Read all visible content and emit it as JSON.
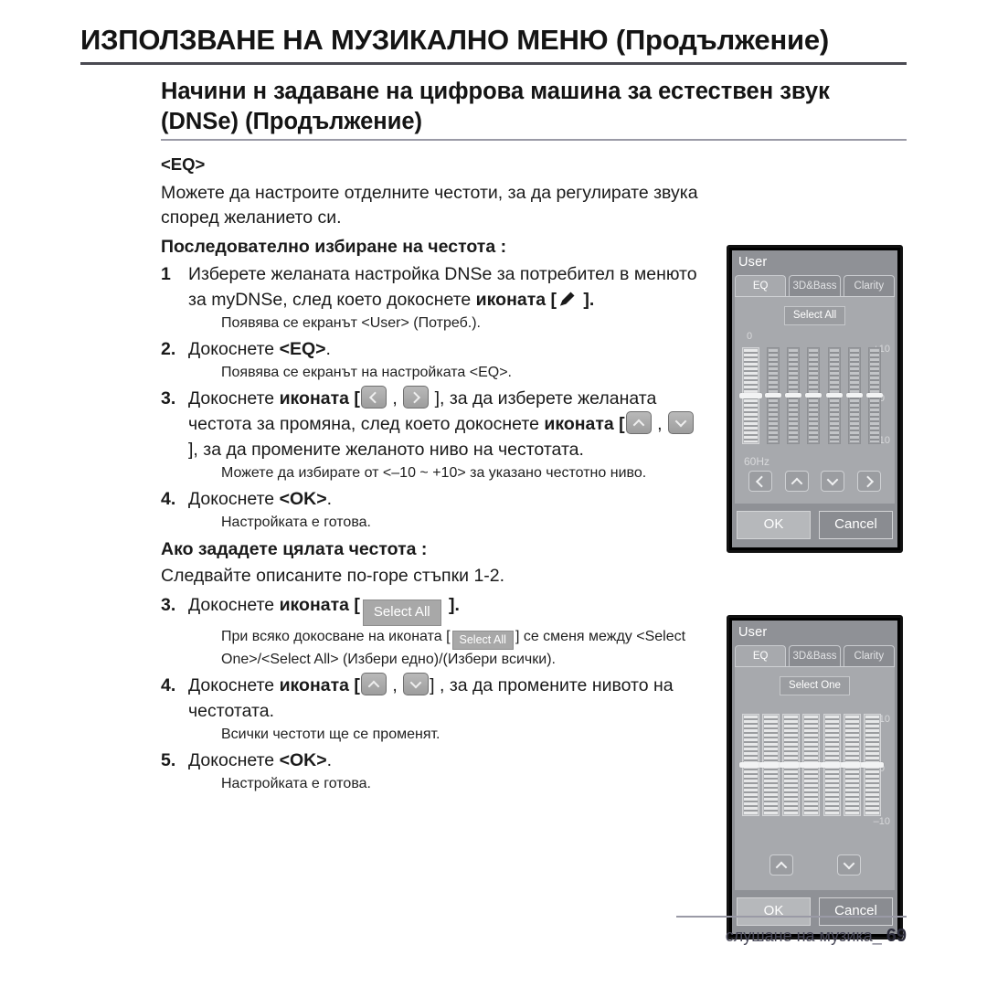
{
  "header": {
    "chapter_title": "ИЗПОЛЗВАНЕ НА МУЗИКАЛНО МЕНЮ (Продължение)",
    "section_title": "Начини н задаване на цифрова машина за естествен звук (DNSe) (Продължение)"
  },
  "body": {
    "eq_tag": "<EQ>",
    "intro": "Можете да настроите отделните честоти, за да регулирате звука според желанието си.",
    "subhead_sequential": "Последователно избиране на честота :",
    "step1": {
      "num": "1",
      "text_a": "Изберете желаната настройка DNSe за потребител в менюто за myDNSe, след което докоснете ",
      "bold": "иконата",
      "text_b": " [",
      "text_c": " ].",
      "note": "Появява се екранът <User> (Потреб.)."
    },
    "step2": {
      "num": "2.",
      "text_a": "Докоснете ",
      "bold": "<EQ>",
      "text_b": ".",
      "note": "Появява се екранът на настройката <EQ>."
    },
    "step3": {
      "num": "3.",
      "text_a": "Докоснете ",
      "bold1": "иконата",
      "text_b": " [",
      "comma": " , ",
      "text_c": " ], за да изберете желаната честота за промяна, след което докоснете ",
      "bold2": "иконата",
      "text_d": " [",
      "text_e": " ], за да промените желаното ниво на честотата.",
      "note": "Можете да избирате от <–10 ~ +10> за указано честотно ниво."
    },
    "step4": {
      "num": "4.",
      "text_a": "Докоснете ",
      "bold": "<OK>",
      "text_b": ".",
      "note": "Настройката е готова."
    },
    "subhead_all": "Ако зададете цялата честота :",
    "follow_steps": "Следвайте описаните по-горе стъпки 1-2.",
    "step3b": {
      "num": "3.",
      "text_a": "Докоснете ",
      "bold": "иконата",
      "text_b": " [",
      "chip_label": "Select All",
      "text_c": " ].",
      "note_a": "При всяко докосване на иконата [",
      "note_chip": "Select All",
      "note_b": "] се сменя между <Select One>/<Select All> (Избери едно)/(Избери всички)."
    },
    "step4b": {
      "num": "4.",
      "text_a": "Докоснете ",
      "bold": "иконата",
      "text_b": " [",
      "comma": " , ",
      "text_c": "] , за да промените нивото на честотата.",
      "note": "Всички честоти ще се променят."
    },
    "step5b": {
      "num": "5.",
      "text_a": "Докоснете ",
      "bold": "<OK>",
      "text_b": ".",
      "note": "Настройката е готова."
    }
  },
  "device_eq_step": {
    "title": "User",
    "tabs": [
      {
        "label": "EQ",
        "active": true
      },
      {
        "label": "3D&Bass",
        "active": false
      },
      {
        "label": "Clarity",
        "active": false
      }
    ],
    "select_button": "Select All",
    "label_zero_top": "0",
    "label_freq": "60Hz",
    "scale": {
      "top": "+10",
      "mid": "0",
      "bottom": "–10"
    },
    "sliders": [
      {
        "selected": true,
        "value": 0
      },
      {
        "selected": false,
        "value": 0
      },
      {
        "selected": false,
        "value": 0
      },
      {
        "selected": false,
        "value": 0
      },
      {
        "selected": false,
        "value": 0
      },
      {
        "selected": false,
        "value": 0
      },
      {
        "selected": false,
        "value": 0
      }
    ],
    "nav_buttons": [
      "left",
      "up",
      "down",
      "right"
    ],
    "ok_label": "OK",
    "cancel_label": "Cancel"
  },
  "device_eq_all": {
    "title": "User",
    "tabs": [
      {
        "label": "EQ",
        "active": true
      },
      {
        "label": "3D&Bass",
        "active": false
      },
      {
        "label": "Clarity",
        "active": false
      }
    ],
    "select_button": "Select One",
    "scale": {
      "top": "+10",
      "mid": "0",
      "bottom": "–10"
    },
    "sliders": [
      {
        "selected": true,
        "value": 0
      },
      {
        "selected": true,
        "value": 0
      },
      {
        "selected": true,
        "value": 0
      },
      {
        "selected": true,
        "value": 0
      },
      {
        "selected": true,
        "value": 0
      },
      {
        "selected": true,
        "value": 0
      },
      {
        "selected": true,
        "value": 0
      }
    ],
    "nav_buttons": [
      "up",
      "down"
    ],
    "ok_label": "OK",
    "cancel_label": "Cancel"
  },
  "footer": {
    "caption": "слушане на музика",
    "dash": "_",
    "page_number": "69"
  },
  "colors": {
    "rule_dark": "#4a4a52",
    "rule_light": "#9a9aa6",
    "device_chrome": "#8f9196",
    "device_panel": "#a7a9ad",
    "text": "#141414",
    "footer_text": "#4a4a5a"
  }
}
